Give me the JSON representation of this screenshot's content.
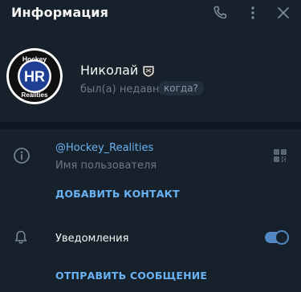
{
  "header": {
    "title": "Информация",
    "icons": [
      "phone-icon",
      "more-vertical-icon",
      "close-icon"
    ]
  },
  "profile": {
    "avatar_lines": [
      "Hockey",
      "HR",
      "Realities"
    ],
    "name": "Николай",
    "name_badge_icon": "nhl-logo-icon",
    "status": "был(а) недавно",
    "when_label": "когда?"
  },
  "info": {
    "username": "@Hockey_Realities",
    "username_label": "Имя пользователя",
    "add_contact": "ДОБАВИТЬ КОНТАКТ",
    "notifications_label": "Уведомления",
    "notifications_on": true,
    "send_message": "ОТПРАВИТЬ СООБЩЕНИЕ"
  },
  "colors": {
    "background": "#17212b",
    "divider": "#0e1621",
    "accent": "#6ab3f3",
    "toggle": "#5288c1",
    "muted": "#6d7883"
  }
}
